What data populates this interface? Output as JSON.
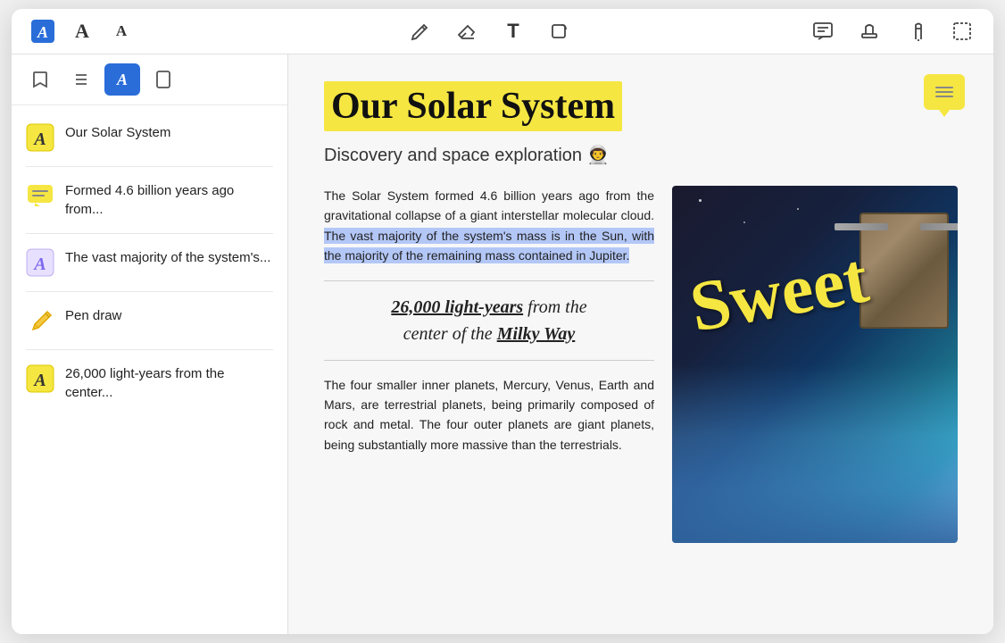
{
  "toolbar": {
    "icons": [
      {
        "name": "font-main-icon",
        "symbol": "𝔸",
        "label": "Font Main"
      },
      {
        "name": "font-a-icon",
        "symbol": "A",
        "label": "Font A"
      },
      {
        "name": "font-a-small-icon",
        "symbol": "A",
        "label": "Font A Small"
      },
      {
        "name": "pencil-icon",
        "symbol": "✏",
        "label": "Pencil"
      },
      {
        "name": "eraser-icon",
        "symbol": "⬦",
        "label": "Eraser"
      },
      {
        "name": "text-icon",
        "symbol": "T",
        "label": "Text"
      },
      {
        "name": "shape-icon",
        "symbol": "⬜",
        "label": "Shape"
      },
      {
        "name": "comment-icon",
        "symbol": "💬",
        "label": "Comment"
      },
      {
        "name": "stamp-icon",
        "symbol": "⬛",
        "label": "Stamp"
      },
      {
        "name": "pen-icon",
        "symbol": "✒",
        "label": "Pen"
      },
      {
        "name": "select-icon",
        "symbol": "⬚",
        "label": "Select"
      }
    ]
  },
  "sidebar": {
    "tabs": [
      {
        "name": "bookmark-tab",
        "symbol": "🔖",
        "label": "Bookmark",
        "active": false
      },
      {
        "name": "list-tab",
        "symbol": "☰",
        "label": "List",
        "active": false
      },
      {
        "name": "annotation-tab",
        "symbol": "A",
        "label": "Annotation",
        "active": true
      },
      {
        "name": "page-tab",
        "symbol": "⬜",
        "label": "Page",
        "active": false
      }
    ],
    "items": [
      {
        "id": "item-solar-system",
        "icon_type": "yellow-a",
        "icon": "A",
        "text": "Our Solar System",
        "multiline": false
      },
      {
        "id": "item-formed",
        "icon_type": "comment",
        "icon": "💬",
        "text": "Formed 4.6 billion years ago from...",
        "multiline": true
      },
      {
        "id": "item-vast-majority",
        "icon_type": "purple-a",
        "icon": "A",
        "text": "The vast majority of the system's...",
        "multiline": true
      },
      {
        "id": "item-pen-draw",
        "icon_type": "pencil",
        "icon": "✏",
        "text": "Pen draw",
        "multiline": false
      },
      {
        "id": "item-lightyears",
        "icon_type": "yellow-a",
        "icon": "A",
        "text": "26,000 light-years from the center...",
        "multiline": true
      }
    ]
  },
  "document": {
    "title": "Our Solar System",
    "subtitle": "Discovery and space exploration 👨‍🚀",
    "para1": "The Solar System formed 4.6 billion years ago from the gravitational collapse of a giant interstellar molecular cloud.",
    "para1_highlight": "The vast majority of the system's mass is in the Sun, with the majority of the remaining mass contained in Jupiter.",
    "quote_line1": "26,000 light-years",
    "quote_line2": "from the",
    "quote_line3": "center of the",
    "quote_line4": "Milky Way",
    "para2": "The four smaller inner planets, Mercury, Venus, Earth and Mars, are terrestrial planets, being primarily composed of rock and metal. The four outer planets are giant planets, being substantially more massive than the terrestrials.",
    "handwriting": "Sweet"
  }
}
